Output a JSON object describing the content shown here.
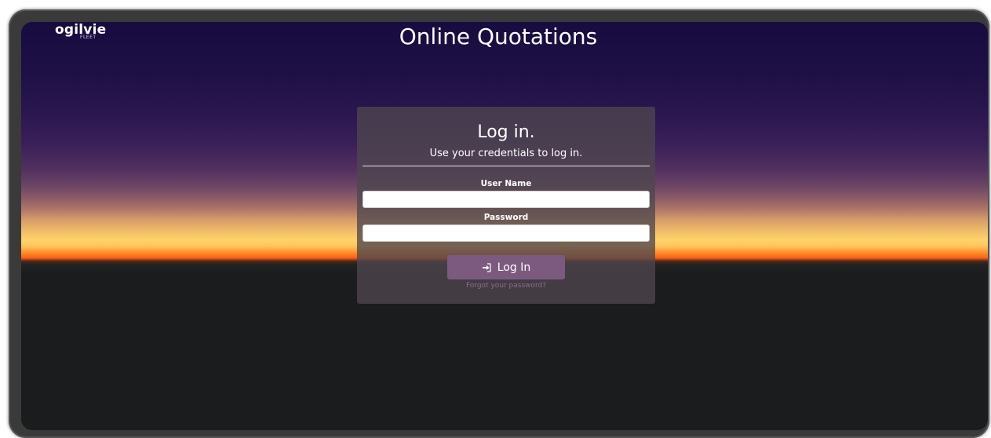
{
  "header": {
    "logo_text": "ogilvie",
    "logo_subtext": "FLEET",
    "app_title": "Online Quotations"
  },
  "login": {
    "title": "Log in.",
    "subtitle": "Use your credentials to log in.",
    "username_label": "User Name",
    "username_value": "",
    "password_label": "Password",
    "password_value": "",
    "button_label": "Log In",
    "button_icon": "sign-in-icon",
    "forgot_link": "Forgot your password?"
  },
  "colors": {
    "sky_top": "#170b40",
    "horizon_orange": "#ff5e12",
    "horizon_yellow": "#ffd36a",
    "ground": "#1b1c1d",
    "button_bg": "#7c5a80",
    "panel_bg": "#4e464e"
  }
}
